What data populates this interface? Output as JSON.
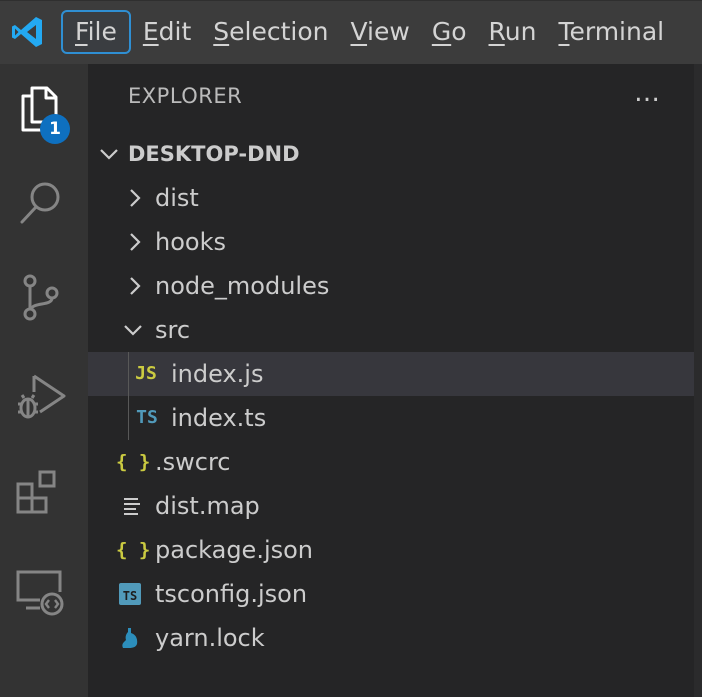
{
  "menu": {
    "items": [
      "File",
      "Edit",
      "Selection",
      "View",
      "Go",
      "Run",
      "Terminal"
    ],
    "underlined": [
      "F",
      "E",
      "S",
      "V",
      "G",
      "R",
      "T"
    ],
    "active_index": 0
  },
  "activity_bar": {
    "icons": [
      "files-icon",
      "search-icon",
      "source-control-icon",
      "run-debug-icon",
      "extensions-icon",
      "remote-explorer-icon"
    ],
    "explorer_badge": "1"
  },
  "explorer": {
    "title": "EXPLORER",
    "more_actions": "…",
    "root_folder": "DESKTOP-DND",
    "items": [
      {
        "label": "dist",
        "type": "folder",
        "expanded": false
      },
      {
        "label": "hooks",
        "type": "folder",
        "expanded": false
      },
      {
        "label": "node_modules",
        "type": "folder",
        "expanded": false
      },
      {
        "label": "src",
        "type": "folder",
        "expanded": true
      },
      {
        "label": "index.js",
        "type": "file",
        "icon": "JS",
        "selected": true
      },
      {
        "label": "index.ts",
        "type": "file",
        "icon": "TS"
      },
      {
        "label": ".swcrc",
        "type": "file",
        "icon": "{ }"
      },
      {
        "label": "dist.map",
        "type": "file",
        "icon": "lines"
      },
      {
        "label": "package.json",
        "type": "file",
        "icon": "{ }"
      },
      {
        "label": "tsconfig.json",
        "type": "file",
        "icon": "TS"
      },
      {
        "label": "yarn.lock",
        "type": "file",
        "icon": "yarn"
      }
    ]
  },
  "colors": {
    "accent": "#0e70c0",
    "js": "#cbcb41",
    "ts": "#519aba",
    "selection": "#37373d"
  }
}
